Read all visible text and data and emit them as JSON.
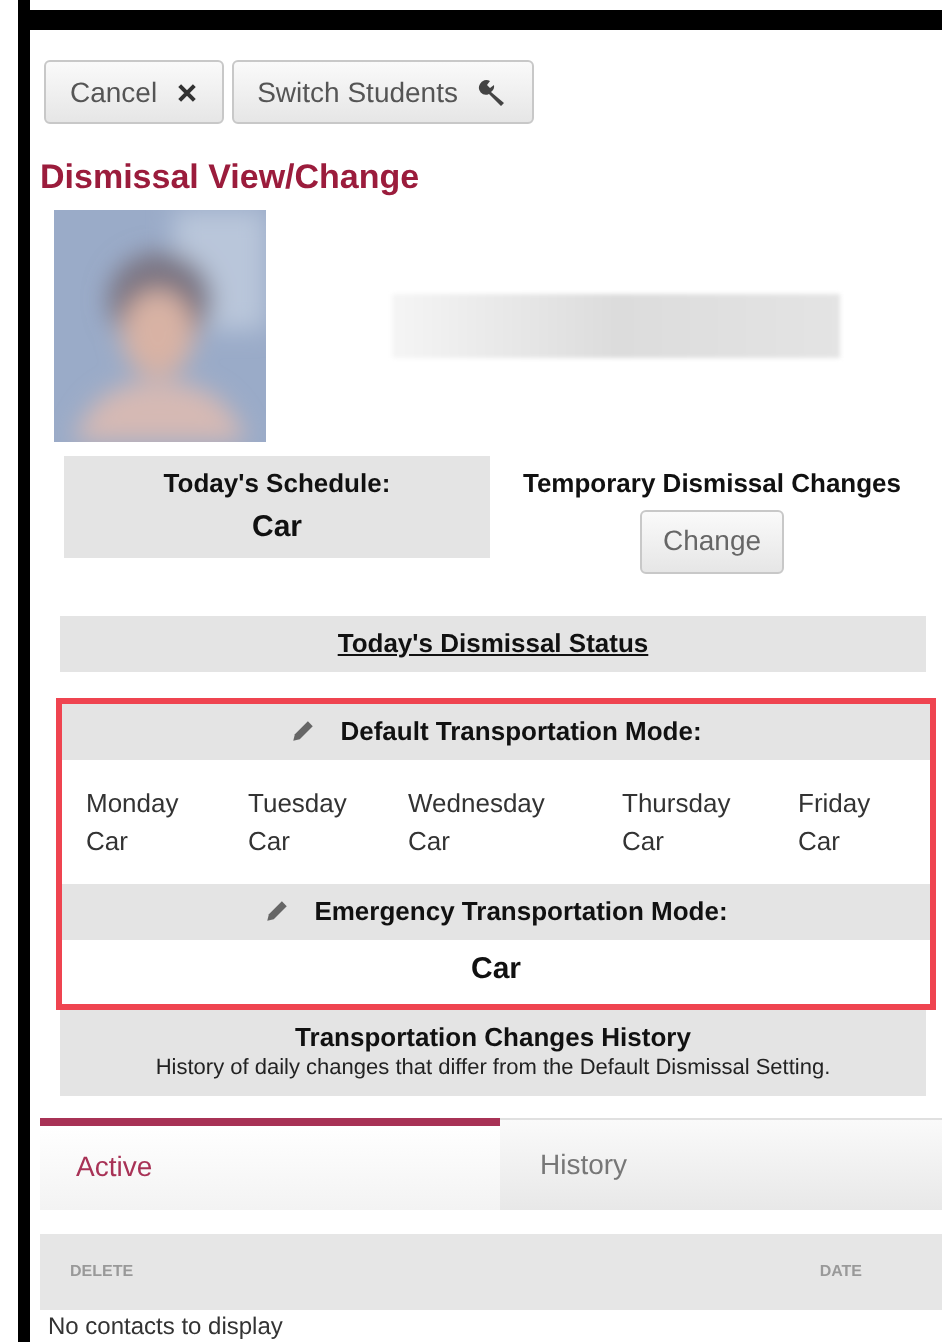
{
  "toolbar": {
    "buttons": [
      {
        "label": "Cancel",
        "kind": "close"
      },
      {
        "label": "Switch Students",
        "kind": "wrench"
      }
    ]
  },
  "title": "Dismissal View/Change",
  "schedule": {
    "label": "Today's Schedule:",
    "value": "Car"
  },
  "temporary_changes": {
    "label": "Temporary Dismissal Changes",
    "button": "Change"
  },
  "status_link": "Today's Dismissal Status",
  "default_mode": {
    "title": "Default Transportation Mode:",
    "highlighted": true,
    "days": [
      {
        "day": "Monday",
        "mode": "Car"
      },
      {
        "day": "Tuesday",
        "mode": "Car"
      },
      {
        "day": "Wednesday",
        "mode": "Car"
      },
      {
        "day": "Thursday",
        "mode": "Car"
      },
      {
        "day": "Friday",
        "mode": "Car"
      }
    ]
  },
  "emergency_mode": {
    "title": "Emergency Transportation Mode:",
    "value": "Car"
  },
  "history": {
    "title": "Transportation Changes History",
    "description": "History of daily changes that differ from the Default Dismissal Setting."
  },
  "tabs": [
    {
      "label": "Active",
      "selected": true
    },
    {
      "label": "History",
      "selected": false
    }
  ],
  "table": {
    "columns": [
      "DELETE",
      "DATE"
    ],
    "empty_text": "No contacts to display"
  }
}
